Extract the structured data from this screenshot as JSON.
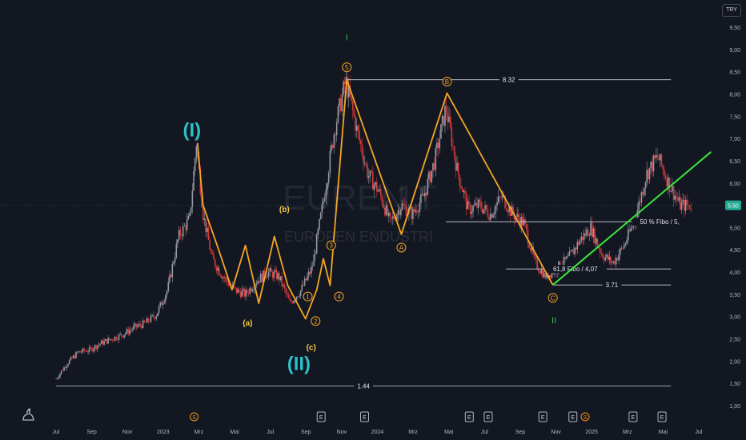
{
  "symbol": {
    "ticker": "EUREN",
    "interval": "1T",
    "full_name": "EUROPEN ENDUSTRI",
    "currency": "TRY",
    "last_price": "5,50"
  },
  "colors": {
    "background": "#131722",
    "candle_up": "#9598a1",
    "candle_down": "#d23a3a",
    "wave_line": "#f5a623",
    "wave_label": "#f5c842",
    "primary_wave": "#2dbfc4",
    "trend_line": "#39e639",
    "roman_label": "#39c24a",
    "level_line": "#d1d4dc",
    "axis_text": "#b2b5be",
    "price_badge": "#22ab94"
  },
  "price_axis": {
    "ticks": [
      "9,50",
      "9,00",
      "8,50",
      "8,00",
      "7,50",
      "7,00",
      "6,50",
      "6,00",
      "5,50",
      "5,00",
      "4,50",
      "4,00",
      "3,50",
      "3,00",
      "2,50",
      "2,00",
      "1,50",
      "1,00"
    ]
  },
  "time_axis": {
    "ticks": [
      "Jul",
      "Sep",
      "Nov",
      "2023",
      "Mrz",
      "Mai",
      "Jul",
      "Sep",
      "Nov",
      "2024",
      "Mrz",
      "Mai",
      "Jul",
      "Sep",
      "Nov",
      "2025",
      "Mrz",
      "Mai",
      "Jul"
    ]
  },
  "events": {
    "dividend": "S",
    "earnings": "E"
  },
  "chart_data": {
    "type": "candlestick",
    "y_range": [
      1.0,
      9.7
    ],
    "t_range": [
      0,
      29
    ],
    "price_series": [
      [
        0,
        1.6
      ],
      [
        0.5,
        1.95
      ],
      [
        1,
        2.2
      ],
      [
        1.5,
        2.25
      ],
      [
        2,
        2.4
      ],
      [
        2.5,
        2.5
      ],
      [
        3,
        2.6
      ],
      [
        3.5,
        2.75
      ],
      [
        4,
        2.85
      ],
      [
        4.5,
        3.05
      ],
      [
        5,
        3.6
      ],
      [
        5.5,
        4.8
      ],
      [
        6,
        5.2
      ],
      [
        6.3,
        6.9
      ],
      [
        6.6,
        5.3
      ],
      [
        7,
        4.3
      ],
      [
        7.5,
        3.9
      ],
      [
        8,
        3.6
      ],
      [
        8.5,
        3.5
      ],
      [
        9,
        3.8
      ],
      [
        9.5,
        4.0
      ],
      [
        10,
        3.9
      ],
      [
        10.5,
        3.3
      ],
      [
        11,
        3.6
      ],
      [
        11.5,
        4.1
      ],
      [
        12,
        5.6
      ],
      [
        12.5,
        7.2
      ],
      [
        13,
        8.3
      ],
      [
        13.5,
        7.2
      ],
      [
        14,
        6.2
      ],
      [
        14.5,
        5.8
      ],
      [
        15,
        5.1
      ],
      [
        15.5,
        5.5
      ],
      [
        16,
        5.3
      ],
      [
        16.5,
        5.7
      ],
      [
        17,
        6.5
      ],
      [
        17.5,
        7.7
      ],
      [
        18,
        6.3
      ],
      [
        18.5,
        5.4
      ],
      [
        19,
        5.5
      ],
      [
        19.5,
        5.3
      ],
      [
        20,
        5.7
      ],
      [
        20.5,
        5.3
      ],
      [
        21,
        5.1
      ],
      [
        21.5,
        4.2
      ],
      [
        22,
        3.9
      ],
      [
        22.5,
        4.1
      ],
      [
        23,
        4.3
      ],
      [
        23.5,
        4.7
      ],
      [
        24,
        5.0
      ],
      [
        24.5,
        4.4
      ],
      [
        25,
        4.2
      ],
      [
        25.5,
        4.6
      ],
      [
        26,
        5.2
      ],
      [
        26.5,
        6.2
      ],
      [
        27,
        6.6
      ],
      [
        27.5,
        6.0
      ],
      [
        28,
        5.5
      ],
      [
        28.5,
        5.5
      ]
    ],
    "horizontal_levels": [
      {
        "price": 8.32,
        "label": "8.32"
      },
      {
        "price": 3.71,
        "label": "3.71"
      },
      {
        "price": 1.44,
        "label": "1.44"
      },
      {
        "price": 4.07,
        "label": "61,8 Fibo / 4,07"
      },
      {
        "price": 5.13,
        "label": "50 % Fibo / 5,"
      }
    ],
    "wave_path": [
      [
        6.35,
        6.9
      ],
      [
        6.6,
        5.5
      ],
      [
        7.3,
        4.5
      ],
      [
        7.9,
        3.6
      ],
      [
        8.5,
        4.6
      ],
      [
        9.1,
        3.3
      ],
      [
        9.8,
        4.8
      ],
      [
        10.4,
        3.7
      ],
      [
        11.2,
        2.95
      ],
      [
        11.7,
        3.6
      ],
      [
        12.0,
        4.3
      ],
      [
        12.3,
        3.7
      ],
      [
        13.05,
        8.32
      ],
      [
        15.5,
        4.85
      ],
      [
        17.55,
        8.02
      ],
      [
        22.3,
        3.71
      ]
    ],
    "trend_line": [
      [
        22.3,
        3.71
      ],
      [
        29.4,
        6.7
      ]
    ],
    "wave_labels": [
      {
        "t": 8.6,
        "p": 2.8,
        "text": "(a)",
        "style": "plain"
      },
      {
        "t": 10.25,
        "p": 5.35,
        "text": "(b)",
        "style": "plain"
      },
      {
        "t": 11.45,
        "p": 2.25,
        "text": "(c)",
        "style": "plain"
      },
      {
        "t": 11.3,
        "p": 3.45,
        "text": "1",
        "style": "circle"
      },
      {
        "t": 11.65,
        "p": 2.9,
        "text": "2",
        "style": "circle"
      },
      {
        "t": 12.35,
        "p": 4.6,
        "text": "3",
        "style": "circle"
      },
      {
        "t": 12.7,
        "p": 3.45,
        "text": "4",
        "style": "circle"
      },
      {
        "t": 13.05,
        "p": 8.6,
        "text": "5",
        "style": "circle"
      },
      {
        "t": 15.5,
        "p": 4.55,
        "text": "A",
        "style": "circle"
      },
      {
        "t": 17.55,
        "p": 8.28,
        "text": "B",
        "style": "circle"
      },
      {
        "t": 22.3,
        "p": 3.42,
        "text": "C",
        "style": "circle"
      }
    ],
    "primary_labels": [
      {
        "t": 6.1,
        "p": 7.05,
        "text": "(I)"
      },
      {
        "t": 10.9,
        "p": 1.8,
        "text": "(II)"
      }
    ],
    "roman_labels": [
      {
        "t": 13.05,
        "p": 9.2,
        "text": "I"
      },
      {
        "t": 22.35,
        "p": 2.85,
        "text": "II"
      }
    ],
    "event_markers": [
      {
        "t": 6.2,
        "kind": "dividend"
      },
      {
        "t": 11.9,
        "kind": "earnings"
      },
      {
        "t": 13.85,
        "kind": "earnings"
      },
      {
        "t": 18.55,
        "kind": "earnings"
      },
      {
        "t": 19.4,
        "kind": "earnings"
      },
      {
        "t": 21.85,
        "kind": "earnings"
      },
      {
        "t": 23.2,
        "kind": "earnings"
      },
      {
        "t": 23.75,
        "kind": "dividend"
      },
      {
        "t": 25.9,
        "kind": "earnings"
      },
      {
        "t": 27.2,
        "kind": "earnings"
      }
    ]
  }
}
